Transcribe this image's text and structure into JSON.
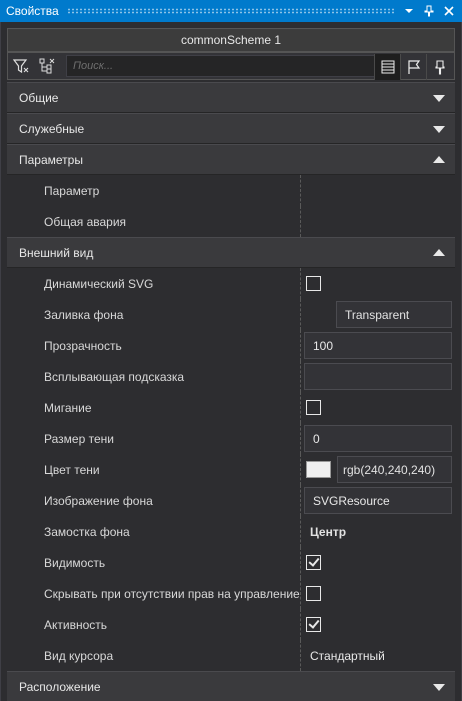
{
  "window": {
    "title": "Свойства",
    "dropdown_icon": "chevron-down-icon",
    "pin_icon": "pin-icon",
    "close_icon": "close-icon"
  },
  "object_name": "commonScheme 1",
  "toolbar": {
    "filter_icon": "filter-icon",
    "tree_icon": "hierarchy-icon",
    "search_placeholder": "Поиск...",
    "list_icon": "list-view-icon",
    "flag_icon": "flag-icon",
    "pin_icon": "pushpin-icon"
  },
  "categories": {
    "general": "Общие",
    "service": "Служебные",
    "parameters": "Параметры",
    "appearance": "Внешний вид",
    "layout": "Расположение"
  },
  "parameters": [
    {
      "name": "Параметр"
    },
    {
      "name": "Общая авария"
    }
  ],
  "appearance": {
    "dynamic_svg": {
      "name": "Динамический SVG",
      "checked": false
    },
    "fill": {
      "name": "Заливка фона",
      "value": "Transparent"
    },
    "opacity": {
      "name": "Прозрачность",
      "value": "100"
    },
    "tooltip": {
      "name": "Всплывающая подсказка",
      "value": ""
    },
    "blink": {
      "name": "Мигание",
      "checked": false
    },
    "shadow_size": {
      "name": "Размер тени",
      "value": "0"
    },
    "shadow_color": {
      "name": "Цвет тени",
      "value": "rgb(240,240,240)",
      "swatch": "#f0f0f0"
    },
    "bg_image": {
      "name": "Изображение фона",
      "value": "SVGResource"
    },
    "bg_tiling": {
      "name": "Замостка фона",
      "value": "Центр"
    },
    "visibility": {
      "name": "Видимость",
      "checked": true
    },
    "hide_no_rights": {
      "name": "Скрывать при отсутствии прав на управление",
      "checked": false
    },
    "active": {
      "name": "Активность",
      "checked": true
    },
    "cursor": {
      "name": "Вид курсора",
      "value": "Стандартный"
    }
  },
  "colors": {
    "accent": "#007acc",
    "background": "#2d2d30",
    "category": "#3a3a3d"
  }
}
